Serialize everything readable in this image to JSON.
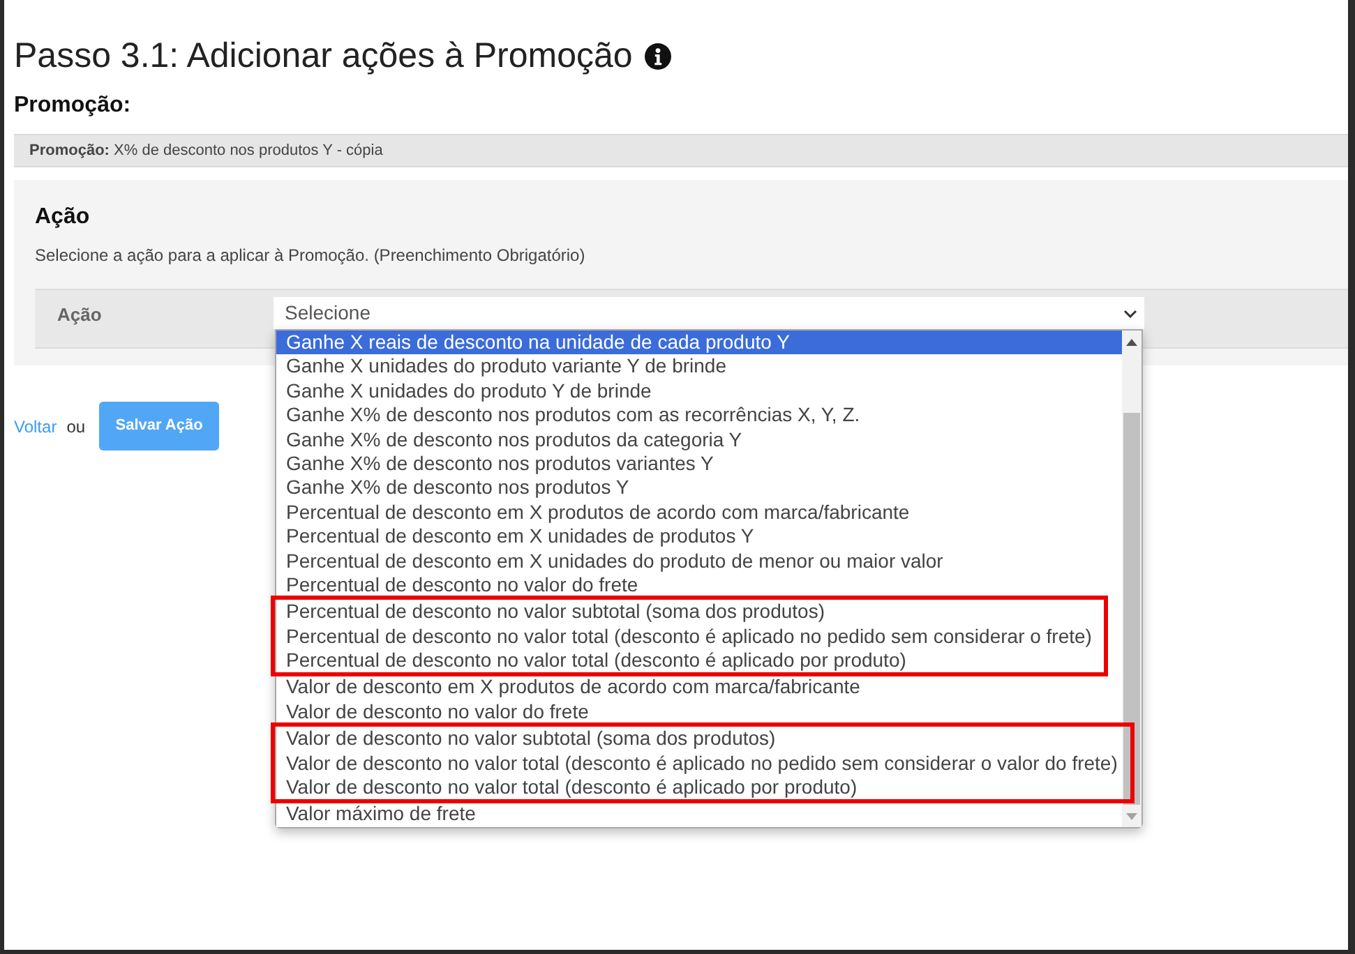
{
  "page": {
    "title": "Passo 3.1: Adicionar ações à Promoção",
    "subtitle": "Promoção:"
  },
  "promotion_bar": {
    "text": "**Promoção:** X% de desconto nos produtos Y - cópia"
  },
  "action_panel": {
    "heading": "Ação",
    "description": "Selecione a ação para a aplicar à Promoção. (Preenchimento Obrigatório)",
    "field_label": "Ação",
    "select": {
      "value": "Selecione",
      "expanded": true,
      "options": [
        {
          "label": "Ganhe X reais de desconto na unidade de cada produto Y",
          "selected": true,
          "highlighted": false
        },
        {
          "label": "Ganhe X unidades do produto variante Y de brinde",
          "selected": false,
          "highlighted": false
        },
        {
          "label": "Ganhe X unidades do produto Y de brinde",
          "selected": false,
          "highlighted": false
        },
        {
          "label": "Ganhe X% de desconto nos produtos com as recorrências X, Y, Z.",
          "selected": false,
          "highlighted": false
        },
        {
          "label": "Ganhe X% de desconto nos produtos da categoria Y",
          "selected": false,
          "highlighted": false
        },
        {
          "label": "Ganhe X% de desconto nos produtos variantes Y",
          "selected": false,
          "highlighted": false
        },
        {
          "label": "Ganhe X% de desconto nos produtos Y",
          "selected": false,
          "highlighted": false
        },
        {
          "label": "Percentual de desconto em X produtos de acordo com marca/fabricante",
          "selected": false,
          "highlighted": false
        },
        {
          "label": "Percentual de desconto em X unidades de produtos Y",
          "selected": false,
          "highlighted": false
        },
        {
          "label": "Percentual de desconto em X unidades do produto de menor ou maior valor",
          "selected": false,
          "highlighted": false
        },
        {
          "label": "Percentual de desconto no valor do frete",
          "selected": false,
          "highlighted": false
        },
        {
          "label": "Percentual de desconto no valor subtotal (soma dos produtos)",
          "selected": false,
          "highlighted": true
        },
        {
          "label": "Percentual de desconto no valor total (desconto é aplicado no pedido sem considerar o frete)",
          "selected": false,
          "highlighted": true
        },
        {
          "label": "Percentual de desconto no valor total (desconto é aplicado por produto)",
          "selected": false,
          "highlighted": true
        },
        {
          "label": "Valor de desconto em X produtos de acordo com marca/fabricante",
          "selected": false,
          "highlighted": false
        },
        {
          "label": "Valor de desconto no valor do frete",
          "selected": false,
          "highlighted": false
        },
        {
          "label": "Valor de desconto no valor subtotal (soma dos produtos)",
          "selected": false,
          "highlighted": true
        },
        {
          "label": "Valor de desconto no valor total (desconto é aplicado no pedido sem considerar o valor do frete)",
          "selected": false,
          "highlighted": true
        },
        {
          "label": "Valor de desconto no valor total (desconto é aplicado por produto)",
          "selected": false,
          "highlighted": true
        },
        {
          "label": "Valor máximo de frete",
          "selected": false,
          "highlighted": false
        }
      ]
    }
  },
  "footer": {
    "back_link": "Voltar",
    "separator": "ou",
    "save_button": "Salvar Ação"
  }
}
